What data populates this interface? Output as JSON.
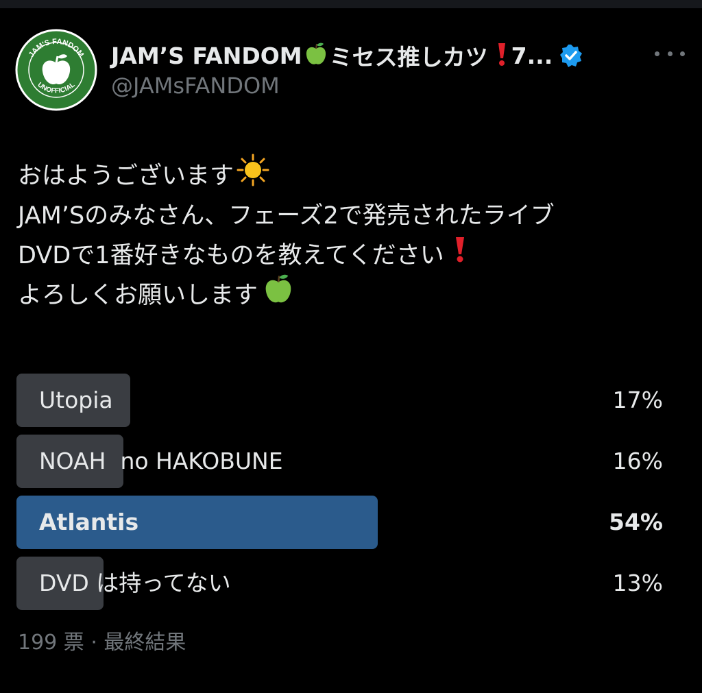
{
  "header": {
    "name": "JAM’S FANDOM",
    "name_suffix": "ミセス推しカツ",
    "name_tail": "7...",
    "handle": "@JAMsFANDOM"
  },
  "avatar": {
    "text_top": "JAM'S FANDOM",
    "text_bottom": "UNOFFICIAL",
    "color": "#2e7d32"
  },
  "tweet": {
    "line1": "おはようございます",
    "line2": "JAM’Sのみなさん、フェーズ2で発売されたライブ",
    "line3": "DVDで1番好きなものを教えてください",
    "line4": "よろしくお願いします"
  },
  "poll": {
    "options": [
      {
        "label": "Utopia",
        "percent": "17%",
        "share": 0.17,
        "winner": false
      },
      {
        "label": "NOAH  no HAKOBUNE",
        "percent": "16%",
        "share": 0.16,
        "winner": false
      },
      {
        "label": "Atlantis",
        "percent": "54%",
        "share": 0.54,
        "winner": true
      },
      {
        "label": "DVD は持ってない",
        "percent": "13%",
        "share": 0.13,
        "winner": false
      }
    ],
    "footer": "199 票 · 最終結果"
  },
  "colors": {
    "background": "#000000",
    "text": "#e7e9ea",
    "muted": "#71767b",
    "bar": "#3a3d42",
    "winner_bar": "#2b5b8c",
    "verified": "#1d9bf0"
  }
}
